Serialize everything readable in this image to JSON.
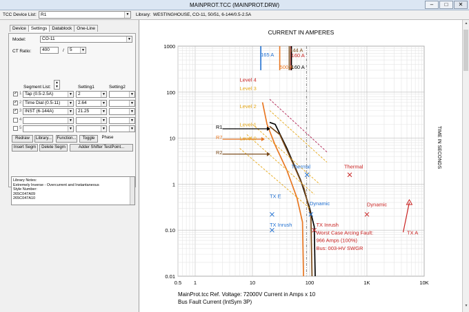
{
  "window": {
    "title": "MAINPROT.TCC (MAINPROT.DRW)",
    "buttons": {
      "minimize": "–",
      "maximize": "□",
      "close": "✕"
    }
  },
  "toolbar": {
    "device_list_label": "TCC Device List:",
    "device_list_value": "R1",
    "library_label": "Library:",
    "library_value": "WESTINGHOUSE, CO-11, 50/51, 6-144/0.5-2.5A"
  },
  "tabs": [
    "Device",
    "Settings",
    "Datablock",
    "One-Line"
  ],
  "settings": {
    "model_label": "Model:",
    "model_value": "CO-11",
    "ct_ratio_label": "CT Ratio:",
    "ct_primary": "400",
    "ct_separator": "/",
    "ct_secondary": "5",
    "segment_list_label": "Segment List:",
    "setting1_label": "Setting1",
    "setting2_label": "Setting2",
    "segments": [
      {
        "num": "1",
        "checked": "✓",
        "name": "Tap (0.5-2.5A)",
        "setting1": "2",
        "setting2": ""
      },
      {
        "num": "2",
        "checked": "✓",
        "name": "Time Dial (0.5-11)",
        "setting1": "2.64",
        "setting2": ""
      },
      {
        "num": "3",
        "checked": "✓",
        "name": "INST (6-144A)",
        "setting1": "21.25",
        "setting2": ""
      },
      {
        "num": "4",
        "checked": "",
        "name": "",
        "setting1": "",
        "setting2": ""
      },
      {
        "num": "5",
        "checked": "",
        "name": "",
        "setting1": "",
        "setting2": ""
      }
    ],
    "buttons_row1": [
      "Redraw",
      "Library...",
      "Function...",
      "Toggle",
      "Phase"
    ],
    "buttons_row2": [
      "Insert Segm",
      "Delete Segm",
      "Adder Shifter TestPoint..."
    ],
    "notes": [
      "Library Notes:",
      "Extremely Inverse - Overcurrent and Instantaneous",
      "Style Number:",
      "265C047A09",
      "265C047A10"
    ]
  },
  "chart_data": {
    "type": "line",
    "title": "CURRENT IN AMPERES",
    "ylabel": "TIME IN SECONDS",
    "xscale": "log",
    "yscale": "log",
    "xlim": [
      0.5,
      10000
    ],
    "ylim": [
      0.01,
      1000
    ],
    "x_ticks": [
      "0.5",
      "1",
      "10",
      "100",
      "1K",
      "10K"
    ],
    "y_ticks": [
      "1000",
      "100",
      "10",
      "1",
      "0.10",
      "0.01"
    ],
    "footer": "MainProt.tcc   Ref. Voltage: 72000V   Current in Amps x 10",
    "footer2": "Bus Fault Current (IntSym 3P)",
    "series": [
      {
        "name": "R1",
        "color": "#000000",
        "points": [
          [
            20,
            22
          ],
          [
            25,
            20
          ],
          [
            40,
            6
          ],
          [
            70,
            1.2
          ],
          [
            100,
            0.3
          ],
          [
            120,
            0.12
          ],
          [
            125,
            0.01
          ]
        ]
      },
      {
        "name": "R7",
        "color": "#e87722",
        "points": [
          [
            15,
            60
          ],
          [
            18,
            20
          ],
          [
            25,
            7
          ],
          [
            40,
            2
          ],
          [
            60,
            0.5
          ],
          [
            75,
            0.15
          ],
          [
            78,
            0.01
          ]
        ]
      },
      {
        "name": "R2",
        "color": "#7a4a1a",
        "points": [
          [
            20,
            18
          ],
          [
            30,
            12
          ],
          [
            50,
            3
          ],
          [
            80,
            0.8
          ],
          [
            105,
            0.2
          ],
          [
            110,
            0.01
          ]
        ]
      },
      {
        "name": "Level 4",
        "color": "#b02050",
        "points": [
          [
            20,
            70
          ],
          [
            200,
            5
          ]
        ]
      },
      {
        "name": "Level 3",
        "color": "#e6a817",
        "points": [
          [
            20,
            40
          ],
          [
            200,
            3
          ]
        ]
      },
      {
        "name": "Level 2",
        "color": "#e6a817",
        "points": [
          [
            10,
            20
          ],
          [
            150,
            1
          ]
        ]
      },
      {
        "name": "Level 1",
        "color": "#e6a817",
        "points": [
          [
            8,
            12
          ],
          [
            120,
            0.6
          ]
        ]
      },
      {
        "name": "Level 0",
        "color": "#e6a817",
        "points": [
          [
            6,
            6
          ],
          [
            100,
            0.3
          ]
        ]
      }
    ],
    "labels": [
      {
        "text": "165 A",
        "x": 14,
        "y": 600,
        "color": "#1f6fd1"
      },
      {
        "text": "144 A",
        "x": 45,
        "y": 750,
        "color": "#7a4a1a"
      },
      {
        "text": "160 A",
        "x": 48,
        "y": 580,
        "color": "#c8201f"
      },
      {
        "text": "500 A",
        "x": 30,
        "y": 320,
        "color": "#e87722"
      },
      {
        "text": "160 A",
        "x": 48,
        "y": 320,
        "color": "#000000"
      },
      {
        "text": "Level 4",
        "x": 6,
        "y": 170,
        "color": "#c8201f"
      },
      {
        "text": "Level 3",
        "x": 6,
        "y": 110,
        "color": "#e6a817"
      },
      {
        "text": "Level 2",
        "x": 6,
        "y": 45,
        "color": "#e6a817"
      },
      {
        "text": "Level 1",
        "x": 6,
        "y": 18,
        "color": "#e6a817"
      },
      {
        "text": "Level 0",
        "x": 6,
        "y": 9,
        "color": "#e6a817"
      },
      {
        "text": "R1",
        "x": 2.3,
        "y": 16,
        "color": "#000000"
      },
      {
        "text": "R7",
        "x": 2.3,
        "y": 9.5,
        "color": "#e87722"
      },
      {
        "text": "R2",
        "x": 2.3,
        "y": 4.5,
        "color": "#7a4a1a"
      },
      {
        "text": "Thermal",
        "x": 48,
        "y": 2.2,
        "color": "#1f6fd1"
      },
      {
        "text": "Thermal",
        "x": 400,
        "y": 2.2,
        "color": "#c8201f"
      },
      {
        "text": "TX E",
        "x": 20,
        "y": 0.5,
        "color": "#1f6fd1"
      },
      {
        "text": "Dynamic",
        "x": 100,
        "y": 0.35,
        "color": "#1f6fd1"
      },
      {
        "text": "Dynamic",
        "x": 1000,
        "y": 0.33,
        "color": "#c8201f"
      },
      {
        "text": "TX Inrush",
        "x": 20,
        "y": 0.12,
        "color": "#1f6fd1"
      },
      {
        "text": "TX Inrush",
        "x": 130,
        "y": 0.12,
        "color": "#c8201f"
      },
      {
        "text": "Worst Case Arcing Fault:",
        "x": 130,
        "y": 0.08,
        "color": "#c8201f"
      },
      {
        "text": "966 Amps (100%)",
        "x": 130,
        "y": 0.055,
        "color": "#c8201f"
      },
      {
        "text": "Bus: 003-HV SWGR",
        "x": 130,
        "y": 0.037,
        "color": "#c8201f"
      },
      {
        "text": "TX A",
        "x": 5000,
        "y": 0.08,
        "color": "#c8201f"
      }
    ]
  }
}
